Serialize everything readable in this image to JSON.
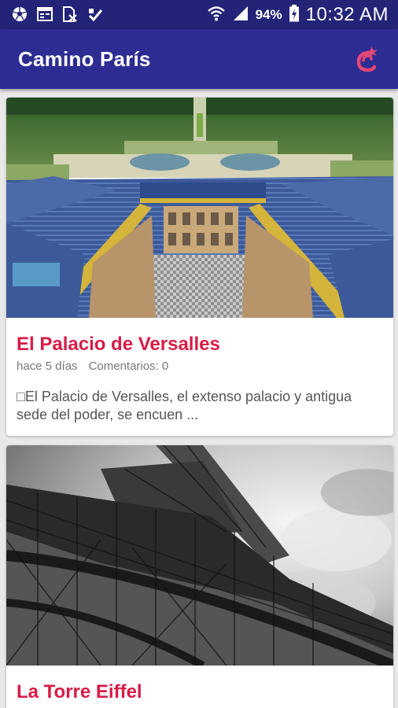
{
  "status_bar": {
    "battery_percent": "94%",
    "time": "10:32 AM",
    "left_icons": [
      "soccer-ball-icon",
      "calendar-icon",
      "document-x-icon",
      "check-icon"
    ],
    "right_icons": [
      "wifi-icon",
      "signal-icon",
      "battery-charging-icon"
    ]
  },
  "app_bar": {
    "title": "Camino París",
    "action_icon": "app-logo-icon"
  },
  "colors": {
    "status_bar": "#232378",
    "app_bar": "#2c2c93",
    "accent": "#d81b46",
    "background": "#e9e9e9"
  },
  "posts": [
    {
      "title": "El Palacio de Versalles",
      "date": "hace 5 días",
      "comments": "Comentarios: 0",
      "excerpt": "□El Palacio de Versalles, el extenso palacio y antigua sede del poder, se encuen ...",
      "image": "aerial view of the Palace of Versailles"
    },
    {
      "title": "La Torre Eiffel",
      "image": "black and white Eiffel Tower from below"
    }
  ]
}
